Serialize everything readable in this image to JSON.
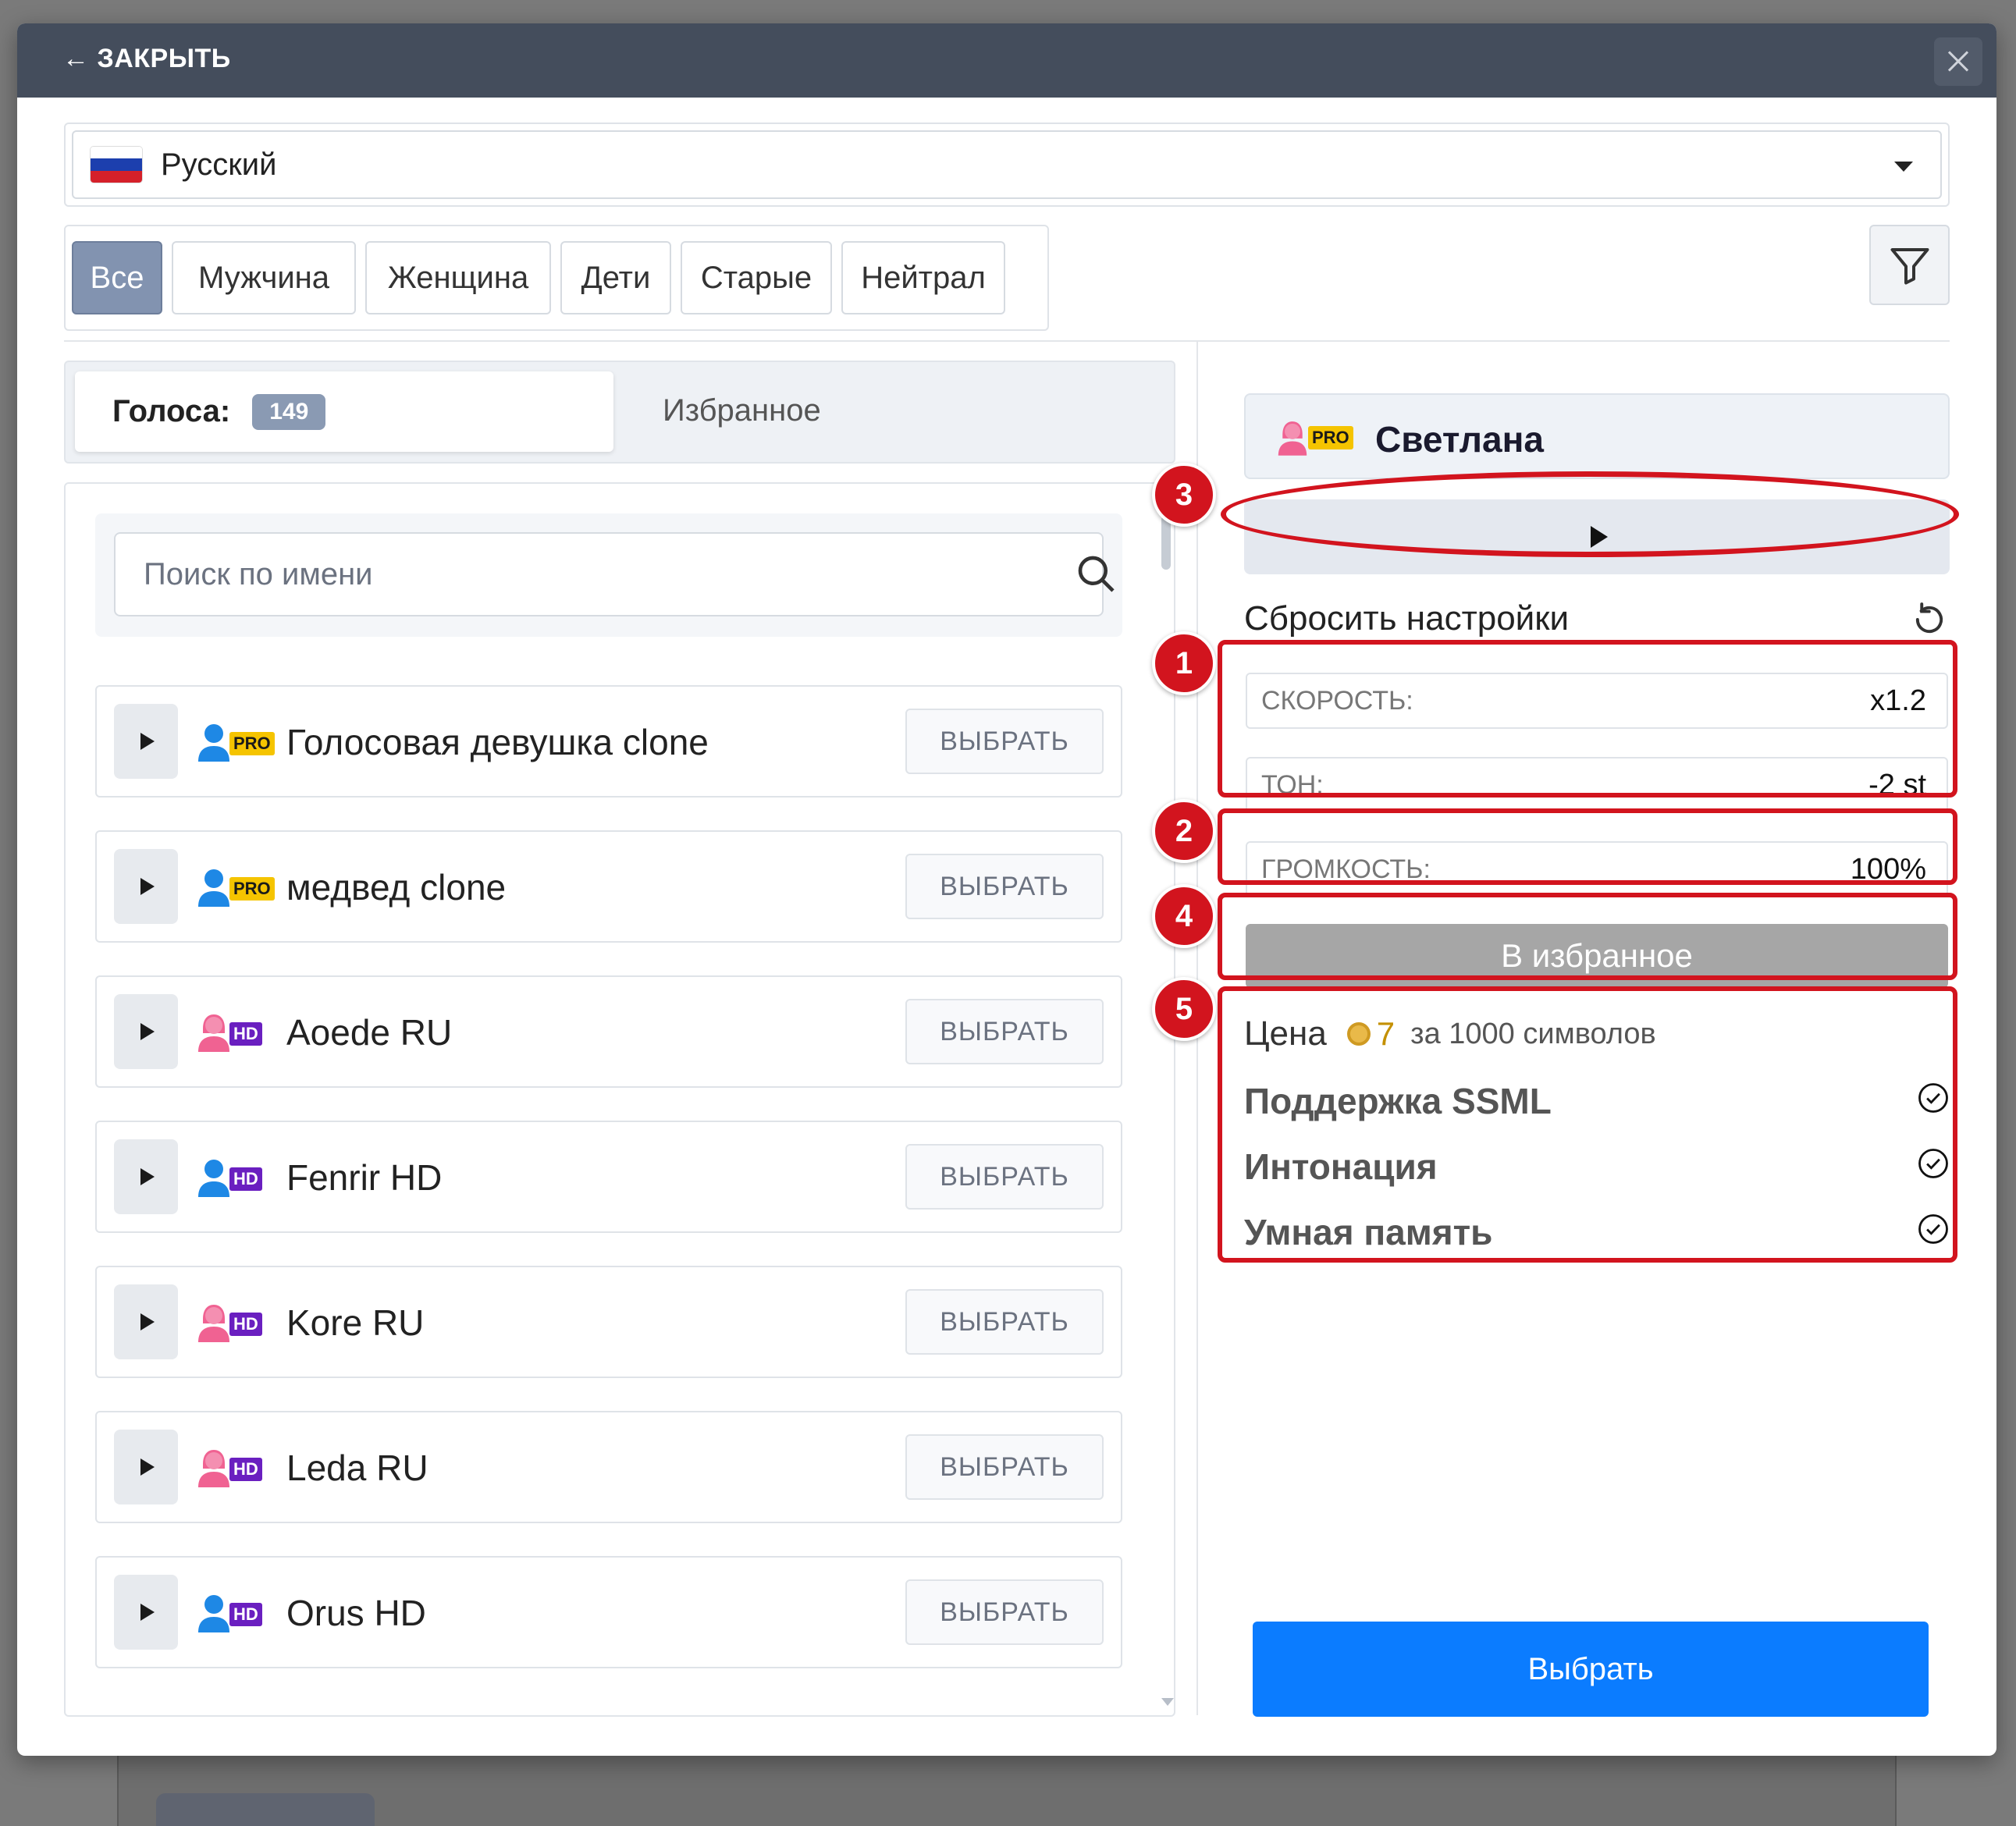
{
  "header": {
    "close_label": "← ЗАКРЫТЬ"
  },
  "language": {
    "selected": "Русский",
    "flag_colors": [
      "#ffffff",
      "#1c3fae",
      "#d5202a"
    ]
  },
  "gender_filters": [
    "Все",
    "Мужчина",
    "Женщина",
    "Дети",
    "Старые",
    "Нейтрал"
  ],
  "tabs": {
    "voices_label": "Голоса:",
    "voices_count": "149",
    "favorites_label": "Избранное"
  },
  "search": {
    "placeholder": "Поиск по имени"
  },
  "voices": [
    {
      "name": "Голосовая девушка clone",
      "tier": "PRO",
      "gender": "male",
      "select_label": "ВЫБРАТЬ"
    },
    {
      "name": "медвед clone",
      "tier": "PRO",
      "gender": "male",
      "select_label": "ВЫБРАТЬ"
    },
    {
      "name": "Aoede RU",
      "tier": "HD",
      "gender": "female",
      "select_label": "ВЫБРАТЬ"
    },
    {
      "name": "Fenrir HD",
      "tier": "HD",
      "gender": "male",
      "select_label": "ВЫБРАТЬ"
    },
    {
      "name": "Kore RU",
      "tier": "HD",
      "gender": "female",
      "select_label": "ВЫБРАТЬ"
    },
    {
      "name": "Leda RU",
      "tier": "HD",
      "gender": "female",
      "select_label": "ВЫБРАТЬ"
    },
    {
      "name": "Orus HD",
      "tier": "HD",
      "gender": "male",
      "select_label": "ВЫБРАТЬ"
    }
  ],
  "detail": {
    "name": "Светлана",
    "tier": "PRO",
    "reset_label": "Сбросить настройки",
    "speed": {
      "label": "СКОРОСТЬ:",
      "value": "x1.2"
    },
    "pitch": {
      "label": "ТОН:",
      "value": "-2 st"
    },
    "volume": {
      "label": "ГРОМКОСТЬ:",
      "value": "100%"
    },
    "favorite_button": "В избранное",
    "price": {
      "label": "Цена",
      "value": "7",
      "suffix": "за 1000 символов"
    },
    "features": [
      "Поддержка SSML",
      "Интонация",
      "Умная память"
    ],
    "choose_button": "Выбрать"
  },
  "annotations": [
    "1",
    "2",
    "3",
    "4",
    "5"
  ],
  "colors": {
    "header_bg": "#444d5c",
    "accent_blue": "#0b7cff",
    "pro_badge": "#f5c400",
    "hd_badge": "#6a1fc0",
    "male_icon": "#1e88e5",
    "female_icon": "#f06292",
    "annotation_red": "#d2141e"
  }
}
